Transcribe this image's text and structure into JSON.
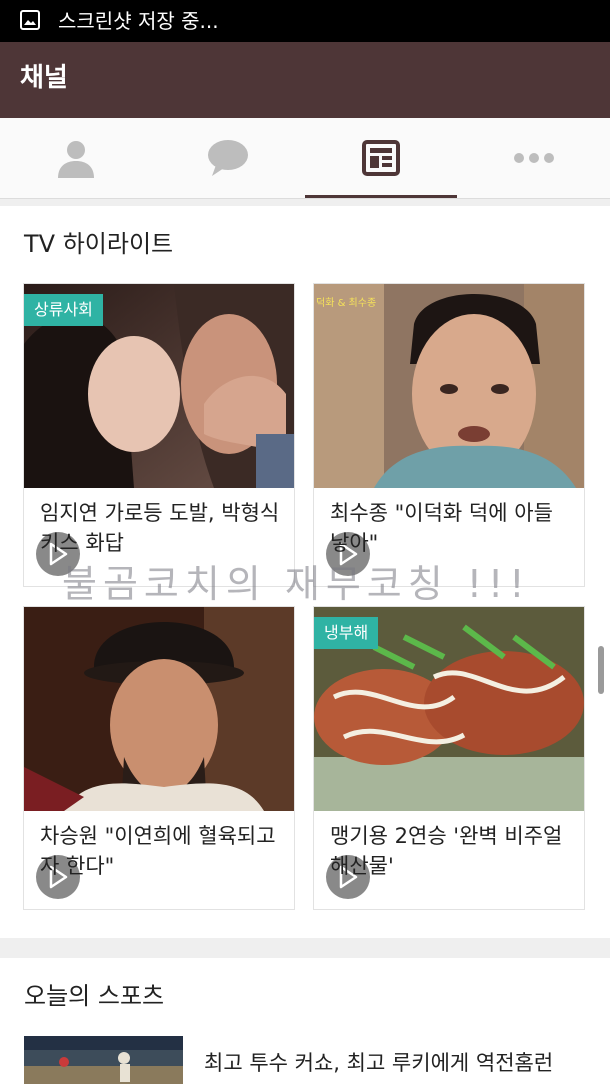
{
  "status_bar": {
    "text": "스크린샷 저장 중...",
    "icon": "image-icon"
  },
  "app_bar": {
    "title": "채널"
  },
  "tabs": [
    {
      "icon": "profile-icon",
      "selected": false
    },
    {
      "icon": "chat-icon",
      "selected": false
    },
    {
      "icon": "channel-icon",
      "selected": true
    },
    {
      "icon": "more-icon",
      "selected": false
    }
  ],
  "tv": {
    "title": "TV 하이라이트",
    "items": [
      {
        "tag": "상류사회",
        "title": "임지연 가로등 도발, 박형식 키스 화답",
        "thumb_caption": ""
      },
      {
        "tag": "",
        "title": "최수종 \"이덕화 덕에 아들 낳아\"",
        "thumb_caption": "덕화 & 최수종"
      },
      {
        "tag": "",
        "title": "차승원 \"이연희에 혈육되고자 한다\"",
        "thumb_caption": ""
      },
      {
        "tag": "냉부해",
        "title": "맹기용 2연승 '완벽 비주얼 해산물'",
        "thumb_caption": ""
      }
    ]
  },
  "watermark": "불곰코치의 재무코칭 !!!",
  "sports": {
    "title": "오늘의 스포츠",
    "items": [
      {
        "title": "최고 투수 커쇼, 최고 루키에게 역전홈런"
      }
    ]
  },
  "colors": {
    "app_bar": "#4e3637",
    "accent": "#2fb3a4",
    "status_bar": "#000000"
  }
}
